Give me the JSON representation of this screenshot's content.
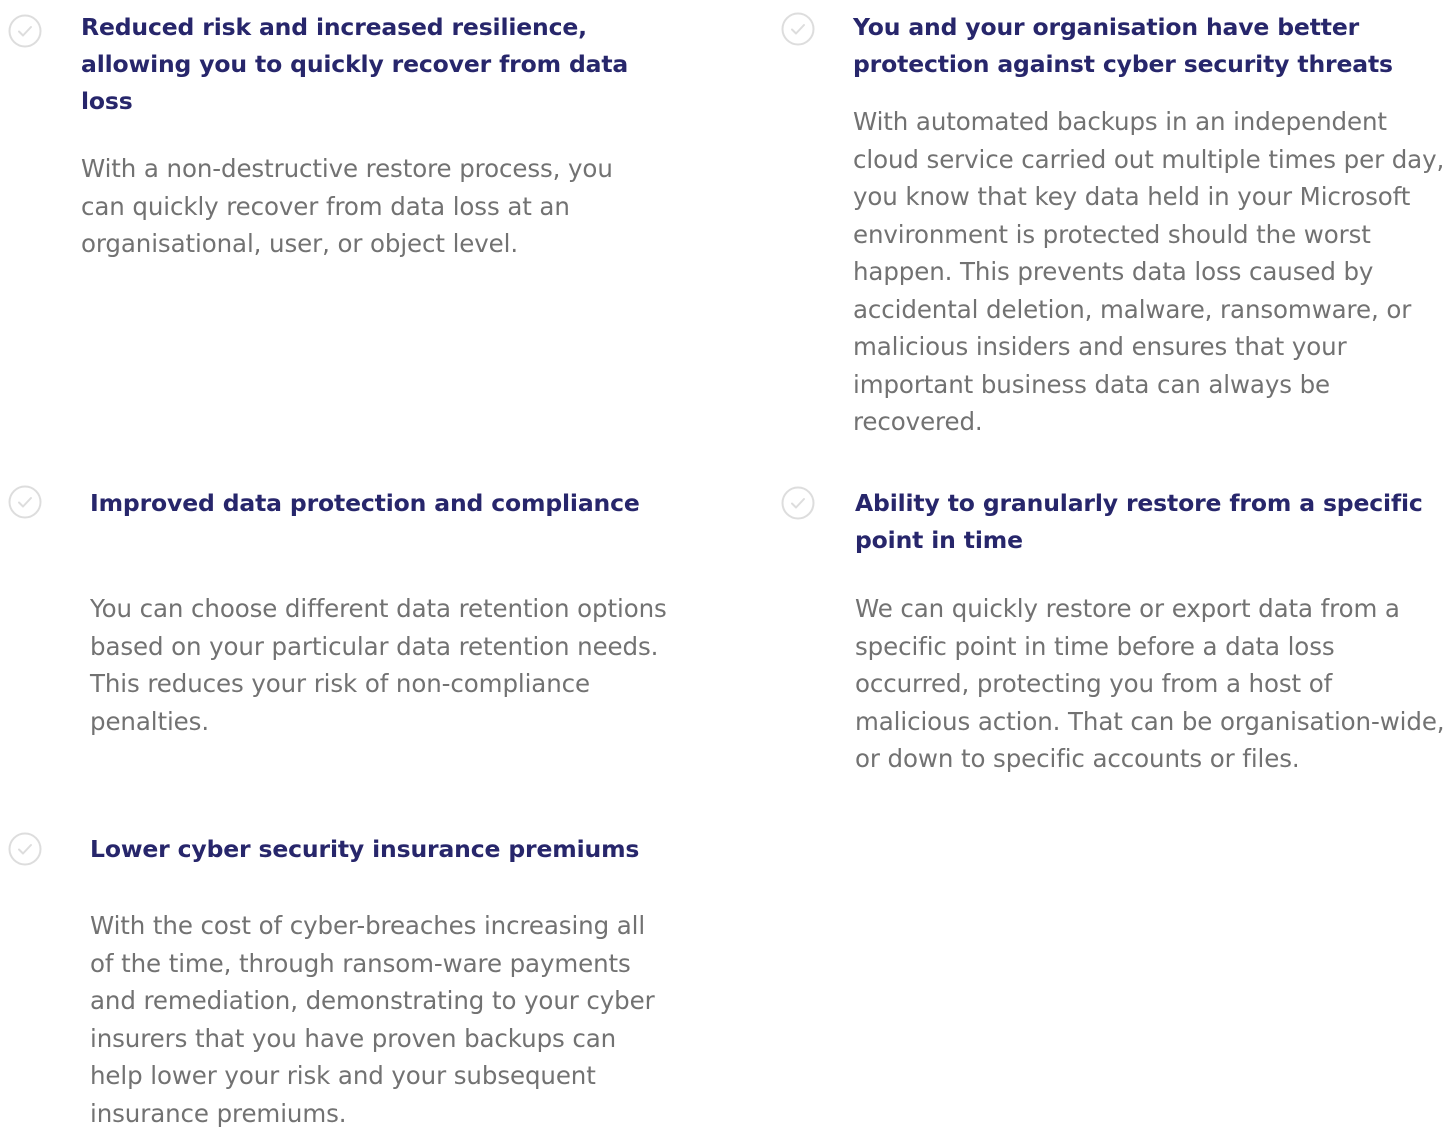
{
  "benefits": [
    {
      "icon": "check-circle-icon",
      "title": "Reduced risk and increased resilience, allowing you to quickly recover from data loss",
      "description": "With a non-destructive restore process, you can quickly recover from data loss at an organisational, user, or object level."
    },
    {
      "icon": "check-circle-icon",
      "title": "You and your organisation have better protection against cyber security threats",
      "description": "With automated backups in an independent cloud service carried out multiple times per day, you know that key data held in your Microsoft environment is protected should the worst happen. This prevents data loss caused by accidental deletion, malware, ransomware, or malicious insiders and ensures that your important business data can always be recovered."
    },
    {
      "icon": "check-circle-icon",
      "title": "Improved data protection and compliance",
      "description": "You can choose different data retention options based on your particular data retention needs. This reduces your risk of non-compliance penalties."
    },
    {
      "icon": "check-circle-icon",
      "title": "Ability to granularly restore from a specific point in time",
      "description": "We can quickly restore or export data from a specific point in time before a data loss occurred, protecting you from a host of malicious action. That can be organisation-wide, or down to specific accounts or files."
    },
    {
      "icon": "check-circle-icon",
      "title": "Lower cyber security insurance premiums",
      "description": "With the cost of cyber-breaches increasing all of the time, through ransom-ware payments and remediation, demonstrating to your cyber insurers that you have proven backups can help lower your risk and your subsequent insurance premiums."
    }
  ],
  "colors": {
    "title": "#27266b",
    "description": "#727272",
    "icon": "#dddddd"
  }
}
